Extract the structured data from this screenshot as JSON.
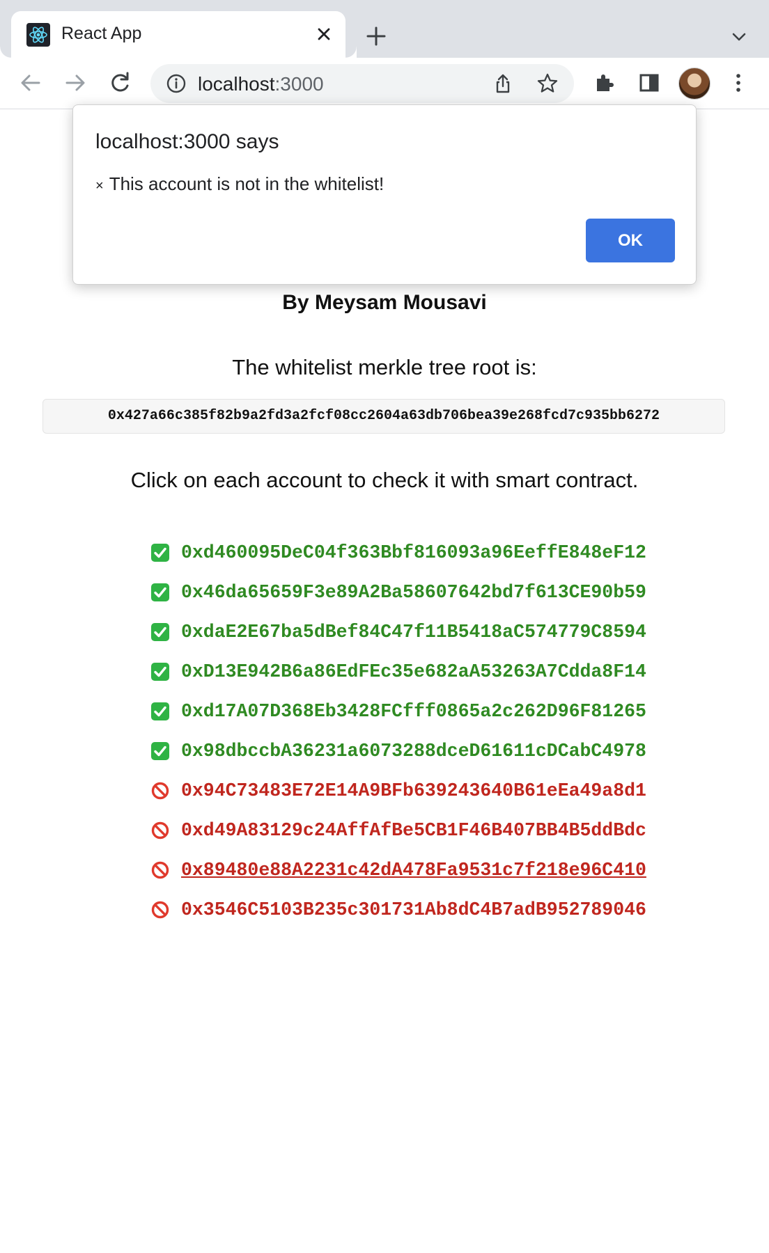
{
  "browser": {
    "tab": {
      "title": "React App"
    },
    "address": {
      "host": "localhost",
      "port": ":3000"
    }
  },
  "dialog": {
    "title": "localhost:3000 says",
    "icon": "×",
    "message": "This account is not in the whitelist!",
    "ok_label": "OK"
  },
  "page": {
    "author": "By Meysam Mousavi",
    "root_heading": "The whitelist merkle tree root is:",
    "root_value": "0x427a66c385f82b9a2fd3a2fcf08cc2604a63db706bea39e268fcd7c935bb6272",
    "instructions": "Click on each account to check it with smart contract."
  },
  "accounts": [
    {
      "address": "0xd460095DeC04f363Bbf816093a96EeffE848eF12",
      "whitelisted": true,
      "icon": "check-mark-icon"
    },
    {
      "address": "0x46da65659F3e89A2Ba58607642bd7f613CE90b59",
      "whitelisted": true,
      "icon": "check-mark-icon"
    },
    {
      "address": "0xdaE2E67ba5dBef84C47f11B5418aC574779C8594",
      "whitelisted": true,
      "icon": "check-mark-icon"
    },
    {
      "address": "0xD13E942B6a86EdFEc35e682aA53263A7Cdda8F14",
      "whitelisted": true,
      "icon": "check-mark-icon"
    },
    {
      "address": "0xd17A07D368Eb3428FCfff0865a2c262D96F81265",
      "whitelisted": true,
      "icon": "check-mark-icon"
    },
    {
      "address": "0x98dbccbA36231a6073288dceD61611cDCabC4978",
      "whitelisted": true,
      "icon": "check-mark-icon"
    },
    {
      "address": "0x94C73483E72E14A9BFb639243640B61eEa49a8d1",
      "whitelisted": false,
      "icon": "prohibited-icon"
    },
    {
      "address": "0xd49A83129c24AffAfBe5CB1F46B407BB4B5ddBdc",
      "whitelisted": false,
      "icon": "prohibited-icon"
    },
    {
      "address": "0x89480e88A2231c42dA478Fa9531c7f218e96C410",
      "whitelisted": false,
      "icon": "prohibited-icon"
    },
    {
      "address": "0x3546C5103B235c301731Ab8dC4B7adB952789046",
      "whitelisted": false,
      "icon": "prohibited-icon"
    }
  ],
  "colors": {
    "whitelisted": "#2f8a22",
    "not_whitelisted": "#c0261e",
    "ok_button": "#3b74e0"
  }
}
